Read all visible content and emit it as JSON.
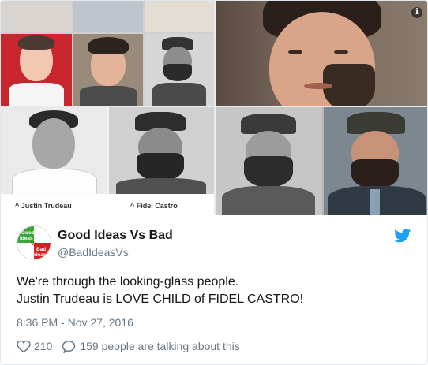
{
  "media": {
    "captions": {
      "left": "^ Justin Trudeau",
      "right": "^ Fidel Castro"
    },
    "info_icon": "info-icon"
  },
  "author": {
    "display_name": "Good Ideas Vs Bad",
    "handle": "@BadIdeasVs",
    "avatar_text": [
      "Good",
      "Ideas",
      "Vs",
      "Bad",
      "Ideas"
    ],
    "brand_color": "#1da1f2"
  },
  "tweet": {
    "lines": [
      "We're through the looking-glass people.",
      "Justin Trudeau is LOVE CHILD of FIDEL CASTRO!"
    ],
    "timestamp": "8:36 PM - Nov 27, 2016"
  },
  "actions": {
    "like_count": "210",
    "reply_text": "159 people are talking about this",
    "like_icon": "heart-icon",
    "reply_icon": "speech-bubble-icon"
  }
}
